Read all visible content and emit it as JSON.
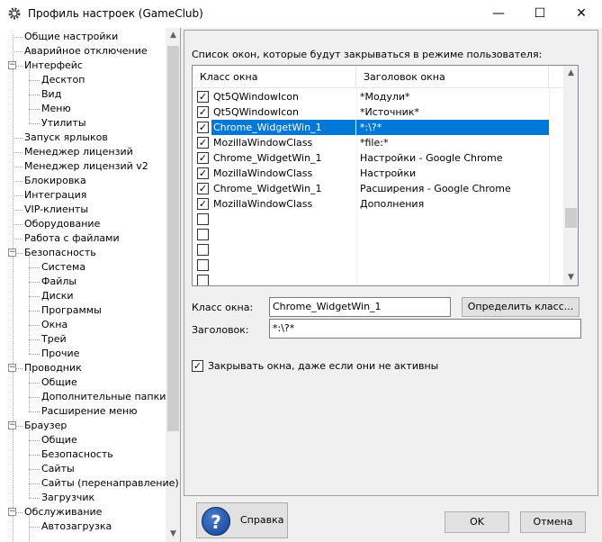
{
  "window": {
    "title": "Профиль настроек (GameClub)",
    "icon": "gear-icon",
    "controls": {
      "minimize": "—",
      "maximize": "☐",
      "close": "✕"
    }
  },
  "tree": {
    "items": [
      {
        "label": "Общие настройки",
        "level": 0
      },
      {
        "label": "Аварийное отключение",
        "level": 0
      },
      {
        "label": "Интерфейс",
        "level": 0,
        "expander": "−"
      },
      {
        "label": "Десктоп",
        "level": 1
      },
      {
        "label": "Вид",
        "level": 1
      },
      {
        "label": "Меню",
        "level": 1
      },
      {
        "label": "Утилиты",
        "level": 1
      },
      {
        "label": "Запуск ярлыков",
        "level": 0
      },
      {
        "label": "Менеджер лицензий",
        "level": 0
      },
      {
        "label": "Менеджер лицензий v2",
        "level": 0
      },
      {
        "label": "Блокировка",
        "level": 0
      },
      {
        "label": "Интеграция",
        "level": 0
      },
      {
        "label": "VIP-клиенты",
        "level": 0
      },
      {
        "label": "Оборудование",
        "level": 0
      },
      {
        "label": "Работа с файлами",
        "level": 0
      },
      {
        "label": "Безопасность",
        "level": 0,
        "expander": "−"
      },
      {
        "label": "Система",
        "level": 1
      },
      {
        "label": "Файлы",
        "level": 1
      },
      {
        "label": "Диски",
        "level": 1
      },
      {
        "label": "Программы",
        "level": 1
      },
      {
        "label": "Окна",
        "level": 1
      },
      {
        "label": "Трей",
        "level": 1
      },
      {
        "label": "Прочие",
        "level": 1
      },
      {
        "label": "Проводник",
        "level": 0,
        "expander": "−"
      },
      {
        "label": "Общие",
        "level": 1
      },
      {
        "label": "Дополнительные папки",
        "level": 1
      },
      {
        "label": "Расширение меню",
        "level": 1
      },
      {
        "label": "Браузер",
        "level": 0,
        "expander": "−"
      },
      {
        "label": "Общие",
        "level": 1
      },
      {
        "label": "Безопасность",
        "level": 1
      },
      {
        "label": "Сайты",
        "level": 1
      },
      {
        "label": "Сайты (перенаправление)",
        "level": 1
      },
      {
        "label": "Загрузчик",
        "level": 1
      },
      {
        "label": "Обслуживание",
        "level": 0,
        "expander": "−"
      },
      {
        "label": "Автозагрузка",
        "level": 1
      }
    ]
  },
  "panel": {
    "list_caption": "Список окон, которые будут закрываться в режиме пользователя:",
    "columns": [
      "Класс окна",
      "Заголовок окна"
    ],
    "rows": [
      {
        "checked": true,
        "class": "Qt5QWindowIcon",
        "title": "*Модули*",
        "selected": false
      },
      {
        "checked": true,
        "class": "Qt5QWindowIcon",
        "title": "*Источник*",
        "selected": false
      },
      {
        "checked": true,
        "class": "Chrome_WidgetWin_1",
        "title": "*:\\?*",
        "selected": true
      },
      {
        "checked": true,
        "class": "MozillaWindowClass",
        "title": "*file:*",
        "selected": false
      },
      {
        "checked": true,
        "class": "Chrome_WidgetWin_1",
        "title": "Настройки - Google Chrome",
        "selected": false
      },
      {
        "checked": true,
        "class": "MozillaWindowClass",
        "title": "Настройки",
        "selected": false
      },
      {
        "checked": true,
        "class": "Chrome_WidgetWin_1",
        "title": "Расширения - Google Chrome",
        "selected": false
      },
      {
        "checked": true,
        "class": "MozillaWindowClass",
        "title": "Дополнения",
        "selected": false
      },
      {
        "checked": false,
        "class": "",
        "title": "",
        "selected": false
      },
      {
        "checked": false,
        "class": "",
        "title": "",
        "selected": false
      },
      {
        "checked": false,
        "class": "",
        "title": "",
        "selected": false
      },
      {
        "checked": false,
        "class": "",
        "title": "",
        "selected": false
      },
      {
        "checked": false,
        "class": "",
        "title": "",
        "selected": false
      }
    ],
    "class_label": "Класс окна:",
    "class_value": "Chrome_WidgetWin_1",
    "detect_button": "Определить класс...",
    "title_label": "Заголовок:",
    "title_value": "*:\\?*",
    "close_inactive_label": "Закрывать окна, даже если они не активны",
    "close_inactive_checked": true
  },
  "footer": {
    "help_button": "Справка",
    "ok_button": "OK",
    "cancel_button": "Отмена"
  },
  "colors": {
    "selection": "#0078d7",
    "help_icon": "#1d4fa3"
  }
}
